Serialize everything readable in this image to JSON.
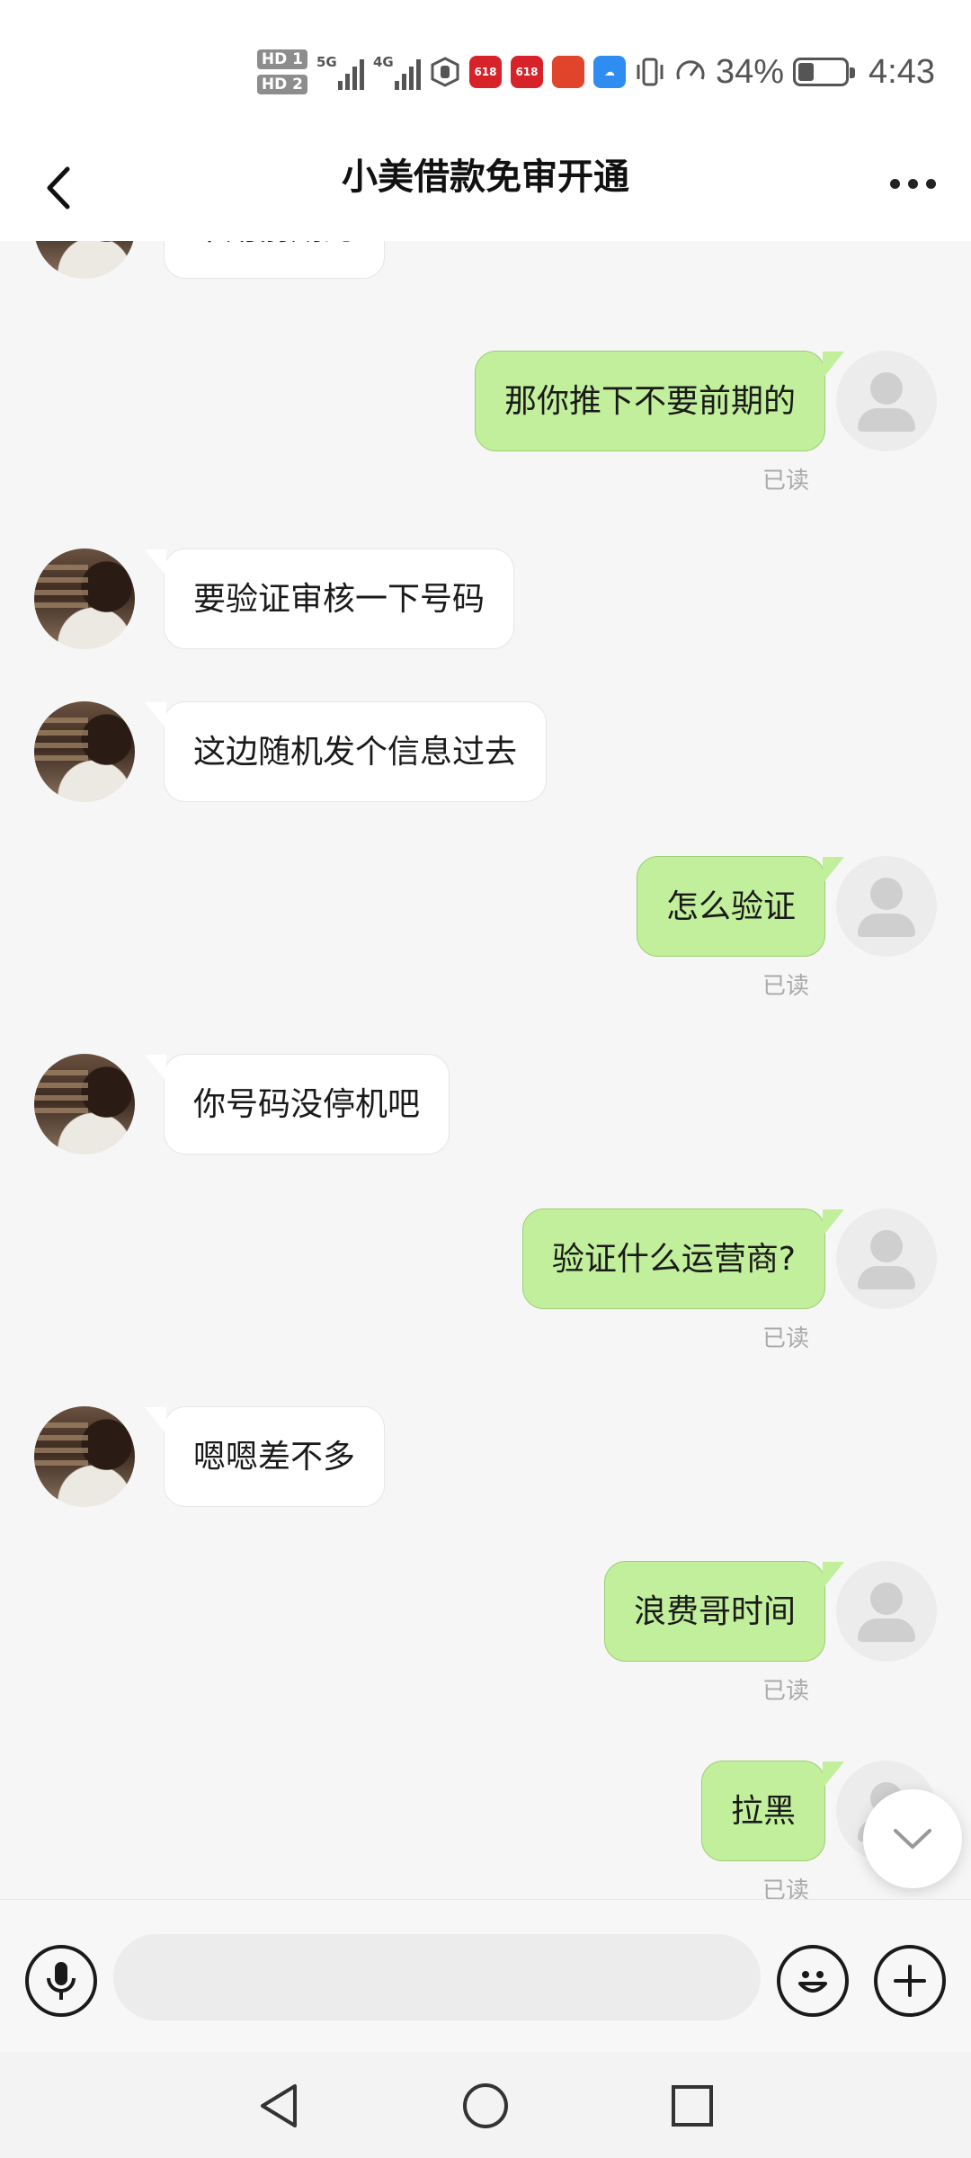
{
  "status_bar": {
    "hd1": "HD 1",
    "hd2": "HD 2",
    "net1": "5G",
    "net2": "4G",
    "app_label": "618",
    "battery": "34%",
    "battery_level": 0.34,
    "time": "4:43"
  },
  "header": {
    "title": "小美借款免审开通"
  },
  "messages": [
    {
      "side": "in",
      "text": "不用前期的"
    },
    {
      "side": "out",
      "text": "那你推下不要前期的",
      "status": "已读"
    },
    {
      "side": "in",
      "text": "要验证审核一下号码"
    },
    {
      "side": "in",
      "text": "这边随机发个信息过去"
    },
    {
      "side": "out",
      "text": "怎么验证",
      "status": "已读"
    },
    {
      "side": "in",
      "text": "你号码没停机吧"
    },
    {
      "side": "out",
      "text": "验证什么运营商?",
      "status": "已读"
    },
    {
      "side": "in",
      "text": "嗯嗯差不多"
    },
    {
      "side": "out",
      "text": "浪费哥时间",
      "status": "已读"
    },
    {
      "side": "out",
      "text": "拉黑",
      "status": "已读"
    }
  ],
  "input": {
    "value": "",
    "placeholder": ""
  },
  "icons": {
    "back": "back-arrow-icon",
    "more": "more-dots-icon",
    "voice": "microphone-icon",
    "emoji": "emoji-icon",
    "add": "plus-icon",
    "scroll_down": "chevron-down-icon",
    "nav_back": "triangle-back-icon",
    "nav_home": "circle-home-icon",
    "nav_recent": "square-recent-icon"
  },
  "colors": {
    "outgoing_bubble": "#c2ef9b",
    "incoming_bubble": "#ffffff",
    "chat_background": "#f6f6f6"
  }
}
